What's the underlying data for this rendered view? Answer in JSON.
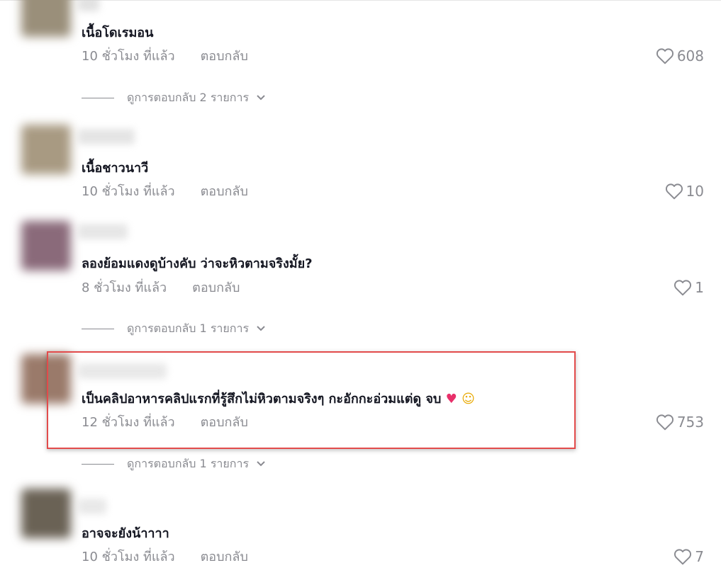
{
  "comments": [
    {
      "text": "เนื้อโดเรมอน",
      "time": "10 ชั่วโมง ที่แล้ว",
      "reply_label": "ตอบกลับ",
      "likes": "608",
      "view_replies": "ดูการตอบกลับ 2 รายการ",
      "avatar_color": "#9a8f7a"
    },
    {
      "text": "เนื้อชาวนาวี",
      "time": "10 ชั่วโมง ที่แล้ว",
      "reply_label": "ตอบกลับ",
      "likes": "10",
      "avatar_color": "#a89a82"
    },
    {
      "text": "ลองย้อมแดงดูบ้างคับ ว่าจะหิวตามจริงมั้ย?",
      "time": "8 ชั่วโมง ที่แล้ว",
      "reply_label": "ตอบกลับ",
      "likes": "1",
      "view_replies": "ดูการตอบกลับ 1 รายการ",
      "avatar_color": "#8a6a7a"
    },
    {
      "text": "เป็นคลิปอาหารคลิปแรกที่รู้สึกไม่หิวตามจริงๆ กะอักกะอ่วมแต่ดู จบ",
      "emoji": [
        "heart",
        "laughing-face"
      ],
      "time": "12 ชั่วโมง ที่แล้ว",
      "reply_label": "ตอบกลับ",
      "likes": "753",
      "view_replies": "ดูการตอบกลับ 1 รายการ",
      "avatar_color": "#9a7a6a"
    },
    {
      "text": "อาจจะยังน้าาาา",
      "time": "10 ชั่วโมง ที่แล้ว",
      "reply_label": "ตอบกลับ",
      "likes": "7",
      "avatar_color": "#6a6255"
    }
  ],
  "colors": {
    "text": "#161823",
    "meta": "#8a8b91",
    "highlight": "#e24b4b"
  },
  "icons": {
    "like": "heart-outline-icon",
    "expand": "chevron-down-icon"
  }
}
